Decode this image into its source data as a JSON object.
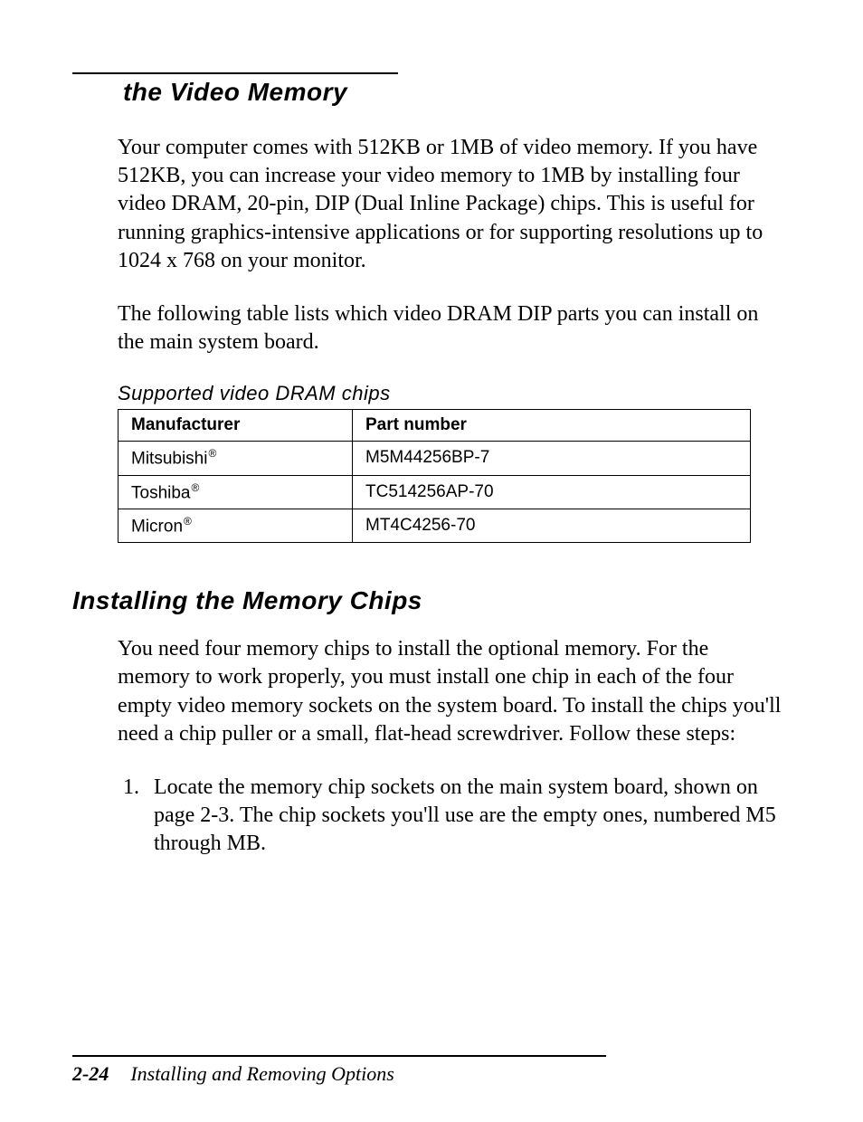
{
  "section": {
    "title": "the Video Memory",
    "para1": "Your computer comes with 512KB or 1MB of video memory. If you have 512KB, you can increase your video memory to 1MB by installing four video DRAM, 20-pin, DIP (Dual Inline Package) chips. This is useful for running graphics-intensive applications or for supporting resolutions up to 1024 x 768 on your monitor.",
    "para2": "The following table lists which video DRAM DIP parts you can install on the main system board."
  },
  "table": {
    "caption": "Supported video DRAM chips",
    "headers": {
      "manufacturer": "Manufacturer",
      "part": "Part number"
    },
    "rows": [
      {
        "manufacturer": "Mitsubishi",
        "part": "M5M44256BP-7"
      },
      {
        "manufacturer": "Toshiba",
        "part": "TC514256AP-70"
      },
      {
        "manufacturer": "Micron",
        "part": "MT4C4256-70"
      }
    ],
    "registered_mark": "®"
  },
  "install": {
    "heading": "Installing the Memory Chips",
    "para": "You need four memory chips to install the optional memory. For the memory to work properly, you must install one chip in each of the four empty video memory sockets on the system board. To install the chips you'll need a chip puller or a small, flat-head screwdriver. Follow these steps:",
    "step1": "Locate the memory chip sockets on the main system board, shown on page 2-3. The chip sockets you'll use are the empty ones, numbered M5 through MB."
  },
  "footer": {
    "page": "2-24",
    "title": "Installing and Removing Options"
  }
}
